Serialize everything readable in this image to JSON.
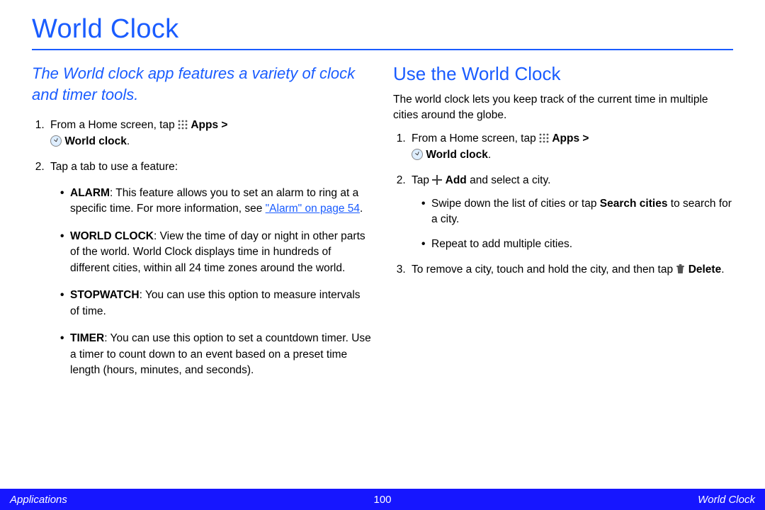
{
  "page": {
    "title": "World Clock",
    "intro": "The World clock app features a variety of clock and timer tools.",
    "left": {
      "step1_prefix": "From a Home screen, tap ",
      "apps_bold": "Apps >",
      "worldclock_bold": "World clock",
      "worldclock_period": ".",
      "step2": "Tap a tab to use a feature:",
      "features": {
        "alarm": {
          "label": "ALARM",
          "text": ": This feature allows you to set an alarm to ring at a specific time. For more information, see ",
          "link": "\"Alarm\" on page 54",
          "period": "."
        },
        "worldclock": {
          "label": "WORLD CLOCK",
          "text": ": View the time of day or night in other parts of the world. World Clock displays time in hundreds of different cities, within all 24 time zones around the world."
        },
        "stopwatch": {
          "label": "STOPWATCH",
          "text": ": You can use this option to measure intervals of time."
        },
        "timer": {
          "label": "TIMER",
          "text": ": You can use this option to set a countdown timer. Use a timer to count down to an event based on a preset time length (hours, minutes, and seconds)."
        }
      }
    },
    "right": {
      "heading": "Use the World Clock",
      "intro": "The world clock lets you keep track of the current time in multiple cities around the globe.",
      "step1_prefix": "From a Home screen, tap ",
      "apps_bold": "Apps >",
      "worldclock_bold": "World clock",
      "worldclock_period": ".",
      "step2_prefix": "Tap ",
      "add_bold": "Add",
      "step2_suffix": " and select a city.",
      "sub1_prefix": "Swipe down the list of cities or tap ",
      "search_bold": "Search cities",
      "sub1_suffix": " to search for a city.",
      "sub2": "Repeat to add multiple cities.",
      "step3_prefix": "To remove a city, touch and hold the city, and then tap ",
      "delete_bold": "Delete",
      "step3_period": "."
    },
    "footer": {
      "left": "Applications",
      "center": "100",
      "right": "World Clock"
    }
  }
}
